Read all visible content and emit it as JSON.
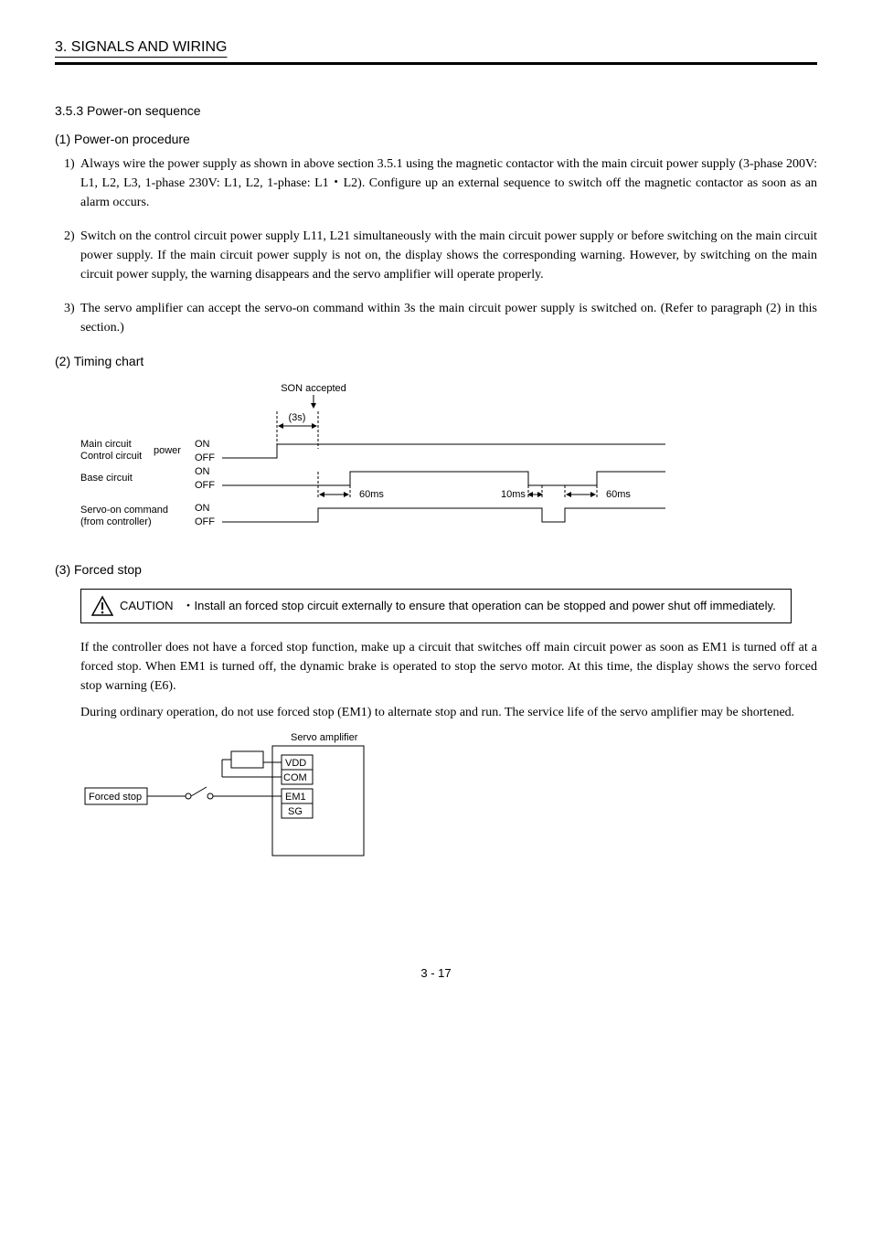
{
  "header": "3. SIGNALS AND WIRING",
  "s353": {
    "title": "3.5.3 Power-on sequence",
    "p1": {
      "title": "(1) Power-on procedure",
      "i1": "Always wire the power supply as shown in above section 3.5.1 using the magnetic contactor with the main circuit power supply (3-phase 200V: L1, L2, L3, 1-phase 230V: L1, L2, 1-phase: L1・L2). Configure up an external sequence to switch off the magnetic contactor as soon as an alarm occurs.",
      "i2": "Switch on the control circuit power supply L11, L21 simultaneously with the main circuit power supply or before switching on the main circuit power supply. If the main circuit power supply is not on, the display shows the corresponding warning. However, by switching on the main circuit power supply, the warning disappears and the servo amplifier will operate properly.",
      "i3": "The servo amplifier can accept the servo-on command within 3s the main circuit power supply is switched on. (Refer to paragraph (2) in this section.)"
    },
    "p2": {
      "title": "(2) Timing chart"
    },
    "p3": {
      "title": "(3) Forced stop",
      "caution_label": "CAUTION",
      "caution_text": "Install an forced stop circuit externally to ensure that operation can be stopped and power shut off immediately.",
      "body1": "If the controller does not have a forced stop function, make up a circuit that switches off main circuit power as soon as EM1 is turned off at a forced stop. When EM1 is turned off, the dynamic brake is operated to stop the servo motor. At this time, the display shows the servo forced stop warning (E6).",
      "body2": "During ordinary operation, do not use forced stop (EM1) to alternate stop and run. The service life of the servo amplifier may be shortened."
    }
  },
  "chart_data": {
    "type": "timing-diagram",
    "title_top": "SON accepted",
    "t_accept": "(3s)",
    "signals": [
      {
        "name": "Main circuit\nControl circuit",
        "suffix": "power",
        "levels": [
          "ON",
          "OFF"
        ]
      },
      {
        "name": "Base circuit",
        "levels": [
          "ON",
          "OFF"
        ]
      },
      {
        "name": "Servo-on command\n(from controller)",
        "levels": [
          "ON",
          "OFF"
        ]
      }
    ],
    "times": [
      "60ms",
      "10ms",
      "60ms"
    ]
  },
  "wiring": {
    "title": "Servo amplifier",
    "forced_stop": "Forced stop",
    "pins": [
      "VDD",
      "COM",
      "EM1",
      "SG"
    ]
  },
  "page": "3 -  17"
}
